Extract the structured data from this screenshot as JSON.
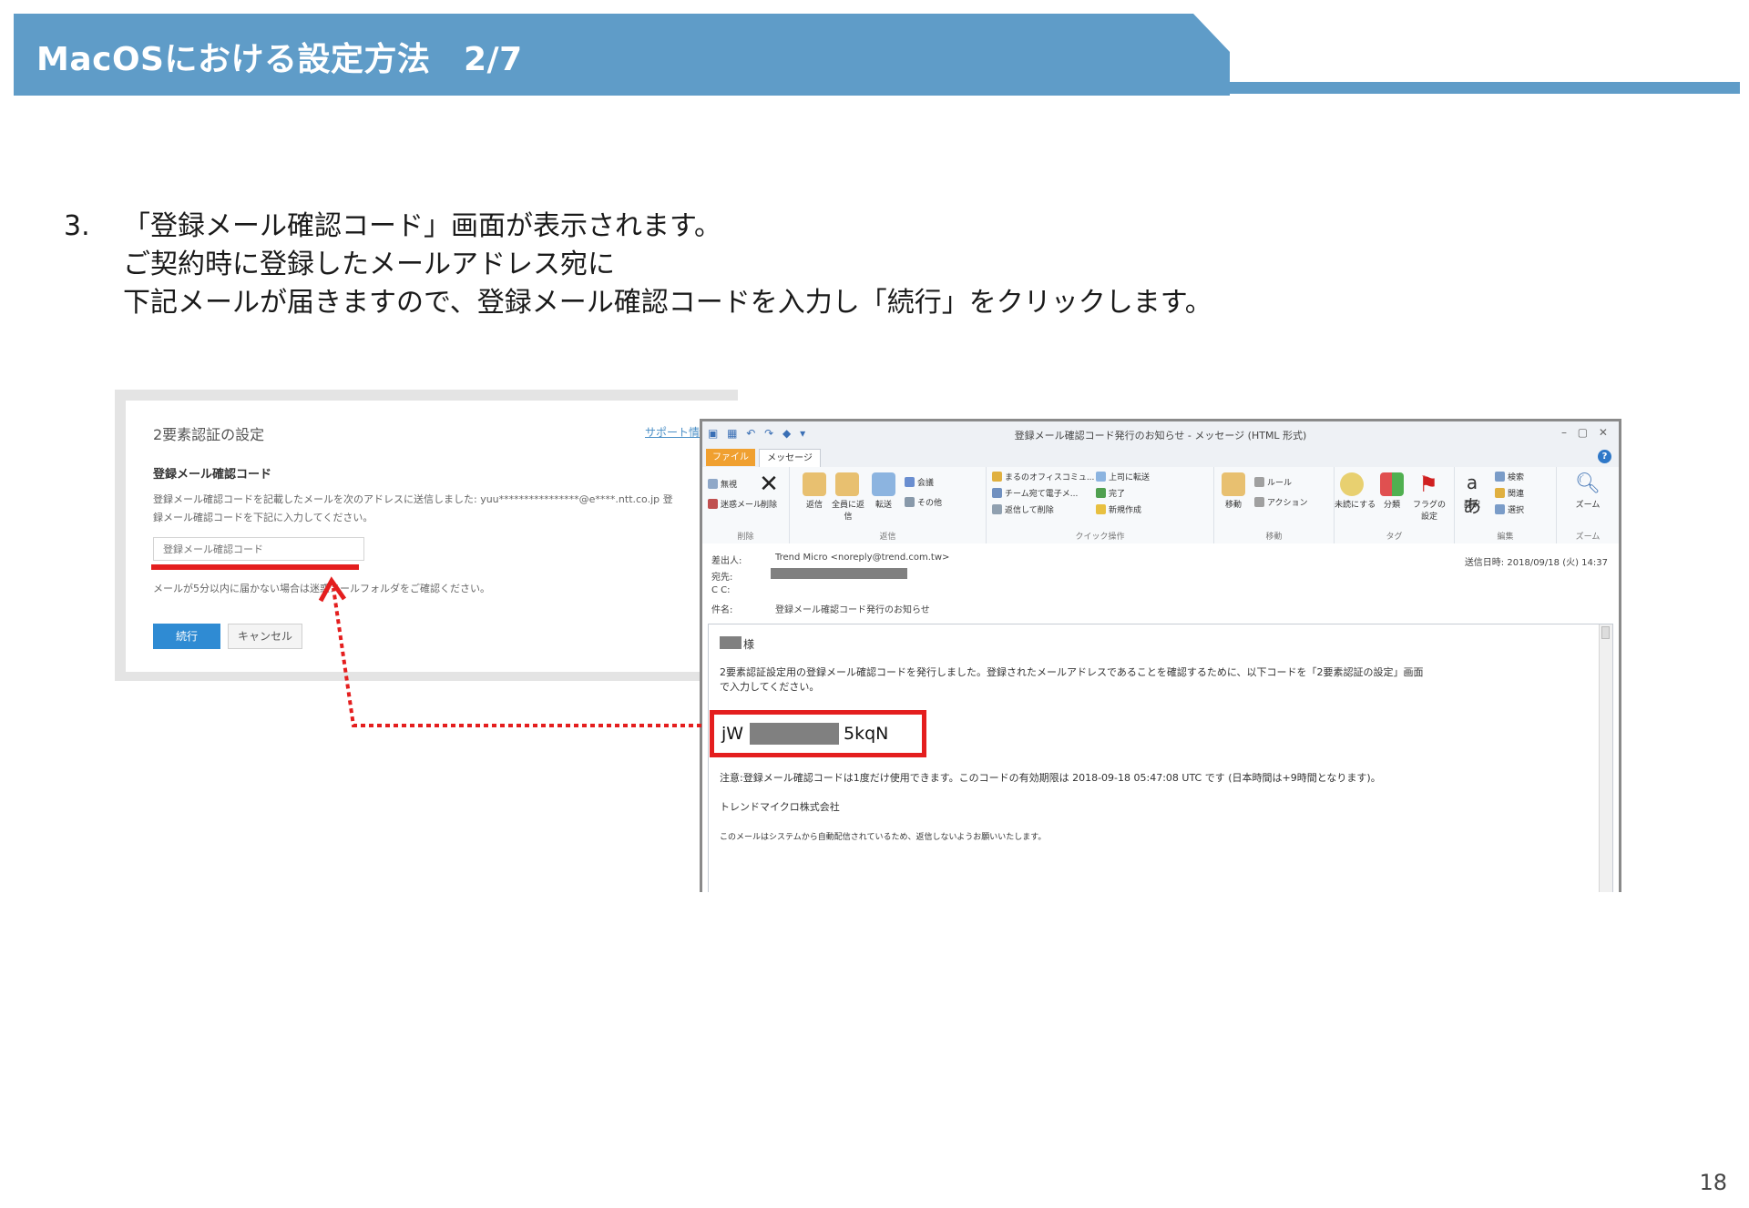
{
  "slide": {
    "title": "MacOSにおける設定方法　2/7",
    "page_number": "18"
  },
  "step": {
    "number": "3.",
    "line1": "「登録メール確認コード」画面が表示されます。",
    "line2": "ご契約時に登録したメールアドレス宛に",
    "line3": "下記メールが届きますので、登録メール確認コードを入力し「続行」をクリックします。"
  },
  "dialog": {
    "title": "2要素認証の設定",
    "support_link": "サポート情報",
    "heading": "登録メール確認コード",
    "desc_line1": "登録メール確認コードを記載したメールを次のアドレスに送信しました: yuu****************@e****.ntt.co.jp 登",
    "desc_line2": "録メール確認コードを下記に入力してください。",
    "input_placeholder": "登録メール確認コード",
    "note": "メールが5分以内に届かない場合は迷惑メールフォルダをご確認ください。",
    "continue_label": "続行",
    "cancel_label": "キャンセル"
  },
  "email": {
    "window_title": "登録メール確認コード発行のお知らせ - メッセージ (HTML 形式)",
    "tab_file": "ファイル",
    "tab_message": "メッセージ",
    "ribbon": {
      "delete": {
        "items": [
          "無視",
          "迷惑メール"
        ],
        "delete_label": "削除",
        "label": "削除"
      },
      "respond": {
        "buttons": [
          "返信",
          "全員に返信",
          "転送"
        ],
        "items": [
          "会議",
          "その他"
        ],
        "label": "返信"
      },
      "quick": {
        "items": [
          "まるのオフィスコミュ...",
          "チーム宛て電子メ...",
          "返信して削除",
          "上司に転送",
          "完了",
          "新規作成"
        ],
        "label": "クイック操作"
      },
      "move": {
        "items": [
          "移動",
          "ルール",
          "アクション"
        ],
        "label": "移動"
      },
      "tags": {
        "items": [
          "未読にする",
          "分類",
          "フラグの設定"
        ],
        "label": "タグ"
      },
      "edit": {
        "items": [
          "翻訳",
          "検索",
          "関連",
          "選択"
        ],
        "label": "編集"
      },
      "zoom": {
        "items": [
          "ズーム"
        ],
        "label": "ズーム"
      }
    },
    "headers": {
      "from_label": "差出人:",
      "from_value": "Trend Micro <noreply@trend.com.tw>",
      "to_label": "宛先:",
      "cc_label": "C C:",
      "subject_label": "件名:",
      "subject_value": "登録メール確認コード発行のお知らせ",
      "sent_label": "送信日時:",
      "sent_value": "2018/09/18 (火) 14:37"
    },
    "body": {
      "salutation": "様",
      "paragraph1": "2要素認証設定用の登録メール確認コードを発行しました。登録されたメールアドレスであることを確認するために、以下コードを「2要素認証の設定」画面",
      "paragraph1b": "で入力してください。",
      "code_prefix": "jW",
      "code_suffix": "5kqN",
      "note": "注意:登録メール確認コードは1度だけ使用できます。このコードの有効期限は 2018-09-18 05:47:08 UTC です (日本時間は+9時間となります)。",
      "company": "トレンドマイクロ株式会社",
      "footer": "このメールはシステムから自動配信されているため、返信しないようお願いいたします。"
    }
  },
  "colors": {
    "banner": "#5f9cc8",
    "highlight_red": "#e41e1e",
    "continue_button": "#2f8bd3"
  }
}
